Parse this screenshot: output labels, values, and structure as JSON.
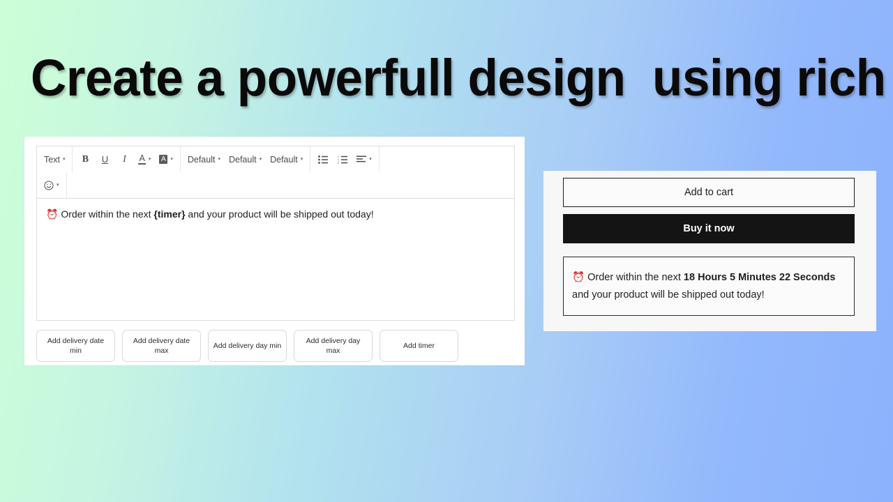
{
  "page": {
    "headline": "Create a powerfull design  using rich editor",
    "background_gradient_from": "#ccffd7",
    "background_gradient_to": "#8cb2fd"
  },
  "editor": {
    "toolbar": {
      "style_dropdown": {
        "label": "Text",
        "caret": "▾"
      },
      "bold": "B",
      "underline": "U",
      "italic": "I",
      "text_color": "A",
      "highlight": "A",
      "font_family": {
        "label": "Default",
        "caret": "▾"
      },
      "font_size": {
        "label": "Default",
        "caret": "▾"
      },
      "line_height": {
        "label": "Default",
        "caret": "▾"
      },
      "bullet_list_icon": "bullet-list-icon",
      "numbered_list_icon": "numbered-list-icon",
      "align_icon": "align-left-icon",
      "emoji": "☺",
      "caret": "▾"
    },
    "content": {
      "emoji": "⏰",
      "text_before": " Order within the next ",
      "token": "{timer}",
      "text_after": " and your product will be shipped out today!"
    },
    "chips": [
      "Add delivery date min",
      "Add delivery date max",
      "Add delivery day min",
      "Add delivery day max",
      "Add timer"
    ]
  },
  "preview": {
    "add_to_cart_label": "Add to cart",
    "buy_now_label": "Buy it now",
    "timer_message": {
      "emoji": "⏰",
      "text_before": " Order within the next ",
      "countdown": "18 Hours 5 Minutes 22 Seconds",
      "text_after": " and your product will be shipped out today!"
    }
  }
}
